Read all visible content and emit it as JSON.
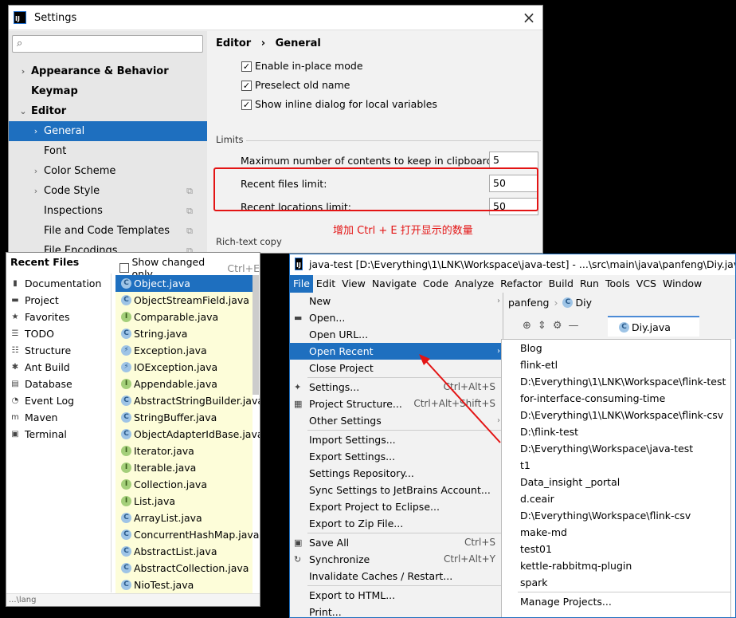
{
  "settings": {
    "title": "Settings",
    "close": "×",
    "search_placeholder": "",
    "breadcrumb": [
      "Editor",
      "›",
      "General"
    ],
    "tree": [
      {
        "label": "Appearance & Behavior",
        "level": 0,
        "arrow": "›",
        "bold": true
      },
      {
        "label": "Keymap",
        "level": 0,
        "arrow": "",
        "bold": true
      },
      {
        "label": "Editor",
        "level": 0,
        "arrow": "⌄",
        "bold": true
      },
      {
        "label": "General",
        "level": 1,
        "arrow": "›",
        "selected": true
      },
      {
        "label": "Font",
        "level": 1,
        "arrow": ""
      },
      {
        "label": "Color Scheme",
        "level": 1,
        "arrow": "›"
      },
      {
        "label": "Code Style",
        "level": 1,
        "arrow": "›",
        "copy": true
      },
      {
        "label": "Inspections",
        "level": 1,
        "arrow": "",
        "copy": true
      },
      {
        "label": "File and Code Templates",
        "level": 1,
        "arrow": "",
        "copy": true
      },
      {
        "label": "File Encodings",
        "level": 1,
        "arrow": "",
        "copy": true
      }
    ],
    "checkboxes": [
      {
        "label": "Enable in-place mode",
        "checked": true
      },
      {
        "label": "Preselect old name",
        "checked": true
      },
      {
        "label": "Show inline dialog for local variables",
        "checked": true
      }
    ],
    "limits_title": "Limits",
    "limits": [
      {
        "label": "Maximum number of contents to keep in clipboard:",
        "value": "5"
      },
      {
        "label": "Recent files limit:",
        "value": "50"
      },
      {
        "label": "Recent locations limit:",
        "value": "50"
      }
    ],
    "richtext_title": "Rich-text copy",
    "annotation": "增加 Ctrl + E 打开显示的数量"
  },
  "recent_files": {
    "title": "Recent Files",
    "show_changed": "Show changed only",
    "shortcut": "Ctrl+E",
    "tools": [
      {
        "label": "Documentation",
        "icon": "documentation-icon",
        "glyph": "▮"
      },
      {
        "label": "Project",
        "icon": "folder-icon",
        "glyph": "▬"
      },
      {
        "label": "Favorites",
        "icon": "star-icon",
        "glyph": "★"
      },
      {
        "label": "TODO",
        "icon": "list-icon",
        "glyph": "☰"
      },
      {
        "label": "Structure",
        "icon": "structure-icon",
        "glyph": "☷"
      },
      {
        "label": "Ant Build",
        "icon": "ant-icon",
        "glyph": "✱"
      },
      {
        "label": "Database",
        "icon": "database-icon",
        "glyph": "▤"
      },
      {
        "label": "Event Log",
        "icon": "event-log-icon",
        "glyph": "◔"
      },
      {
        "label": "Maven",
        "icon": "maven-icon",
        "glyph": "m"
      },
      {
        "label": "Terminal",
        "icon": "terminal-icon",
        "glyph": "▣"
      }
    ],
    "files": [
      {
        "name": "Object.java",
        "kind": "c",
        "selected": true
      },
      {
        "name": "ObjectStreamField.java",
        "kind": "c"
      },
      {
        "name": "Comparable.java",
        "kind": "i"
      },
      {
        "name": "String.java",
        "kind": "c"
      },
      {
        "name": "Exception.java",
        "kind": "e"
      },
      {
        "name": "IOException.java",
        "kind": "e"
      },
      {
        "name": "Appendable.java",
        "kind": "i"
      },
      {
        "name": "AbstractStringBuilder.java",
        "kind": "c"
      },
      {
        "name": "StringBuffer.java",
        "kind": "c"
      },
      {
        "name": "ObjectAdapterIdBase.java",
        "kind": "c"
      },
      {
        "name": "Iterator.java",
        "kind": "i"
      },
      {
        "name": "Iterable.java",
        "kind": "i"
      },
      {
        "name": "Collection.java",
        "kind": "i"
      },
      {
        "name": "List.java",
        "kind": "i"
      },
      {
        "name": "ArrayList.java",
        "kind": "c"
      },
      {
        "name": "ConcurrentHashMap.java",
        "kind": "c"
      },
      {
        "name": "AbstractList.java",
        "kind": "c"
      },
      {
        "name": "AbstractCollection.java",
        "kind": "c"
      },
      {
        "name": "NioTest.java",
        "kind": "c"
      }
    ],
    "status": "...\\lang"
  },
  "ide": {
    "title": "java-test [D:\\Everything\\1\\LNK\\Workspace\\java-test] - ...\\src\\main\\java\\panfeng\\Diy.java [j",
    "menu": [
      "File",
      "Edit",
      "View",
      "Navigate",
      "Code",
      "Analyze",
      "Refactor",
      "Build",
      "Run",
      "Tools",
      "VCS",
      "Window"
    ],
    "breadcrumb": [
      "panfeng",
      "Diy"
    ],
    "tab": "Diy.java",
    "file_menu": [
      {
        "label": "New",
        "sub": true
      },
      {
        "label": "Open...",
        "icon": "▬"
      },
      {
        "label": "Open URL..."
      },
      {
        "label": "Open Recent",
        "sub": true,
        "selected": true
      },
      {
        "label": "Close Project"
      },
      {
        "label": "Settings...",
        "shortcut": "Ctrl+Alt+S",
        "icon": "✦",
        "sep_before": true
      },
      {
        "label": "Project Structure...",
        "shortcut": "Ctrl+Alt+Shift+S",
        "icon": "▦"
      },
      {
        "label": "Other Settings",
        "sub": true
      },
      {
        "label": "Import Settings...",
        "sep_before": true
      },
      {
        "label": "Export Settings..."
      },
      {
        "label": "Settings Repository..."
      },
      {
        "label": "Sync Settings to JetBrains Account..."
      },
      {
        "label": "Export Project to Eclipse..."
      },
      {
        "label": "Export to Zip File..."
      },
      {
        "label": "Save All",
        "shortcut": "Ctrl+S",
        "icon": "▣",
        "sep_before": true
      },
      {
        "label": "Synchronize",
        "shortcut": "Ctrl+Alt+Y",
        "icon": "↻"
      },
      {
        "label": "Invalidate Caches / Restart..."
      },
      {
        "label": "Export to HTML...",
        "sep_before": true
      },
      {
        "label": "Print..."
      }
    ],
    "recent_projects": [
      "Blog",
      "flink-etl",
      "D:\\Everything\\1\\LNK\\Workspace\\flink-test",
      "for-interface-consuming-time",
      "D:\\Everything\\1\\LNK\\Workspace\\flink-csv",
      "D:\\flink-test",
      "D:\\Everything\\Workspace\\java-test",
      "t1",
      "Data_insight _portal",
      "d.ceair",
      "D:\\Everything\\Workspace\\flink-csv",
      "make-md",
      "test01",
      "kettle-rabbitmq-plugin",
      "spark"
    ],
    "manage_projects": "Manage Projects..."
  },
  "colors": {
    "accent": "#1e6fbf",
    "annotation": "#e31414",
    "recent_bg": "#fdfdd9"
  }
}
